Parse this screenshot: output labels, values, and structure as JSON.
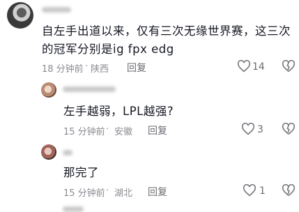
{
  "comments": [
    {
      "text_line1": "自左手出道以来，仅有三次无缘世界赛，这三次",
      "text_line2": "的冠军分别是ig fpx edg",
      "time": "18 分钟前",
      "separator": "·",
      "location": "陕西",
      "reply_label": "回复",
      "likes": "14"
    },
    {
      "text": "左手越弱，LPL越强?",
      "time": "15 分钟前",
      "separator": "·",
      "location": "安徽",
      "reply_label": "回复",
      "likes": "3"
    },
    {
      "text": "那完了",
      "time": "15 分钟前",
      "separator": "·",
      "location": "湖北",
      "reply_label": "回复",
      "likes": "1"
    }
  ],
  "icons": {
    "like": "heart-icon",
    "dislike": "broken-heart-icon"
  },
  "colors": {
    "text": "#161823",
    "meta": "#8a8b91",
    "icon": "#7a7a80"
  }
}
